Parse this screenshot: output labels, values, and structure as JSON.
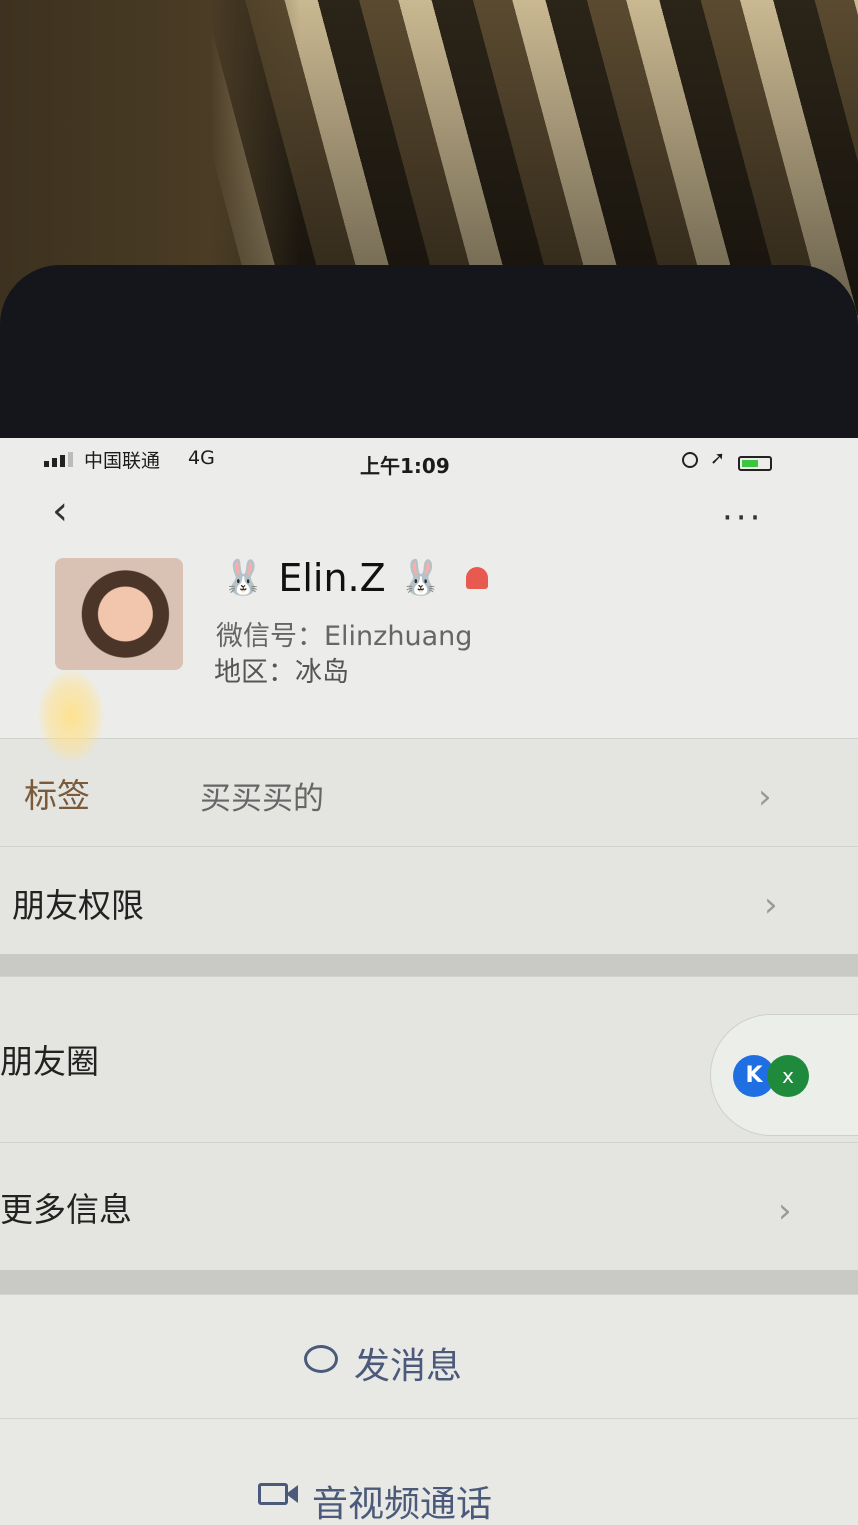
{
  "statusbar": {
    "carrier": "中国联通",
    "network": "4G",
    "time": "上午1:09",
    "battery_level": 0.6,
    "icons": [
      "signal-icon",
      "rotation-lock-icon",
      "location-arrow-icon",
      "battery-charging-icon"
    ]
  },
  "nav": {
    "back_icon": "chevron-left-icon",
    "more_label": "···"
  },
  "profile": {
    "name_prefix": "🐰",
    "name": "Elin.Z",
    "name_suffix": "🐰",
    "gender_icon": "female-icon",
    "gender_color": "#e85a4f",
    "wechat_id": "微信号：Elinzhuang",
    "region": "地区：冰岛"
  },
  "cells": {
    "tags_label": "标签",
    "tags_value": "买买买的",
    "permissions_label": "朋友权限",
    "moments_label": "朋友圈",
    "more_info_label": "更多信息"
  },
  "floating": {
    "badge_k": "K",
    "badge_x": "x"
  },
  "actions": {
    "send_message": "发消息",
    "video_call": "音视频通话"
  },
  "colors": {
    "screen_bg": "#e6e7e3",
    "action_text": "#4b5a7a",
    "badge_blue": "#1f6fe3",
    "badge_green": "#1f8a3c"
  }
}
